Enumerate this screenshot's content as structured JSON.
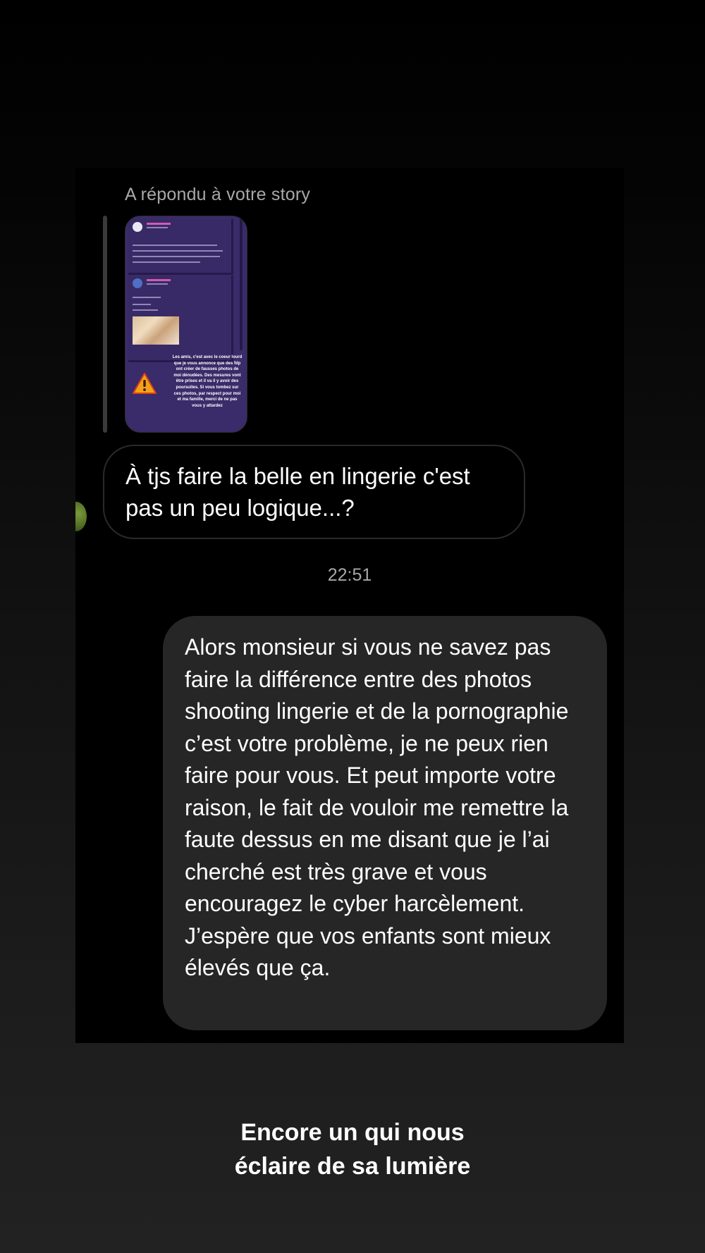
{
  "story_reply": {
    "label": "A répondu à votre story",
    "thumbnail_text": "Les amis, c'est avec le coeur lourd que je vous annonce que des fdp ont créer de fausses photos de moi dénudées. Des mesures vont être prises et il va il y avoir des poursuites. Si vous tombez sur ces photos, par respect pour moi et ma famille, merci de ne pas vous y attardez"
  },
  "messages": {
    "received": "À tjs faire la belle en lingerie c'est pas un peu logique...?",
    "timestamp": "22:51",
    "sent": "Alors monsieur si vous ne savez pas faire la différence entre des photos shooting lingerie et de la pornographie c’est votre problème, je ne peux rien faire pour vous. Et peut importe votre raison, le fait de vouloir me remettre la faute dessus en me disant que je l’ai cherché est très grave et vous encouragez le cyber harcèlement. J’espère que vos enfants sont mieux élevés que ça."
  },
  "caption": {
    "line1": "Encore un qui nous",
    "line2": "éclaire de sa lumière"
  },
  "colors": {
    "background": "#000000",
    "sent_bubble": "#262626",
    "received_border": "#2a2a2a",
    "meta_text": "#a8a8a8",
    "story_bg": "#3a2b6a",
    "warning": "#f2a21a"
  }
}
